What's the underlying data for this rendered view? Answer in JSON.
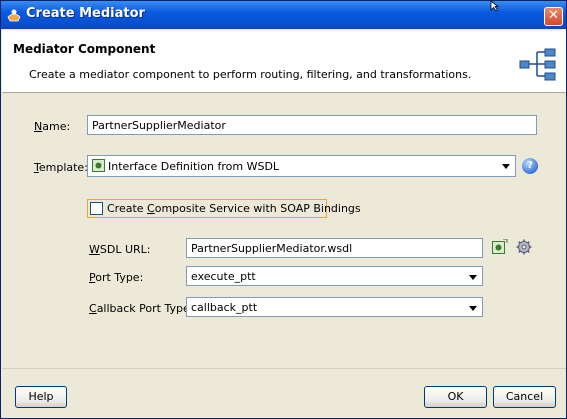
{
  "window": {
    "title": "Create Mediator"
  },
  "header": {
    "title": "Mediator Component",
    "description": "Create a mediator component to perform routing, filtering, and transformations."
  },
  "form": {
    "name": {
      "label_prefix": "N",
      "label_rest": "ame:",
      "value": "PartnerSupplierMediator"
    },
    "template": {
      "label_prefix": "T",
      "label_rest": "emplate:",
      "value": "Interface Definition from WSDL"
    },
    "composite_service": {
      "label_before": "Create ",
      "label_underlined": "C",
      "label_after": "omposite Service with SOAP Bindings",
      "checked": false
    },
    "wsdl_url": {
      "label_prefix": "W",
      "label_rest": "SDL URL:",
      "value": "PartnerSupplierMediator.wsdl"
    },
    "port_type": {
      "label_prefix": "P",
      "label_rest": "ort Type:",
      "value": "execute_ptt"
    },
    "callback_port_type": {
      "label_prefix": "C",
      "label_rest": "allback Port Type:",
      "value": "callback_ptt"
    }
  },
  "buttons": {
    "help": "Help",
    "ok": "OK",
    "cancel": "Cancel"
  },
  "icons": {
    "title": "mediator-app-icon",
    "header": "mediator-component-icon",
    "help": "help-icon",
    "wsdl": "browse-wsdl-icon",
    "gear": "gear-icon",
    "template_item": "wsdl-interface-icon"
  },
  "colors": {
    "titlebar": "#0a5ae0",
    "dialog_bg": "#ece9d8",
    "close_button": "#d8472a",
    "focus_border": "#e8a53c"
  }
}
